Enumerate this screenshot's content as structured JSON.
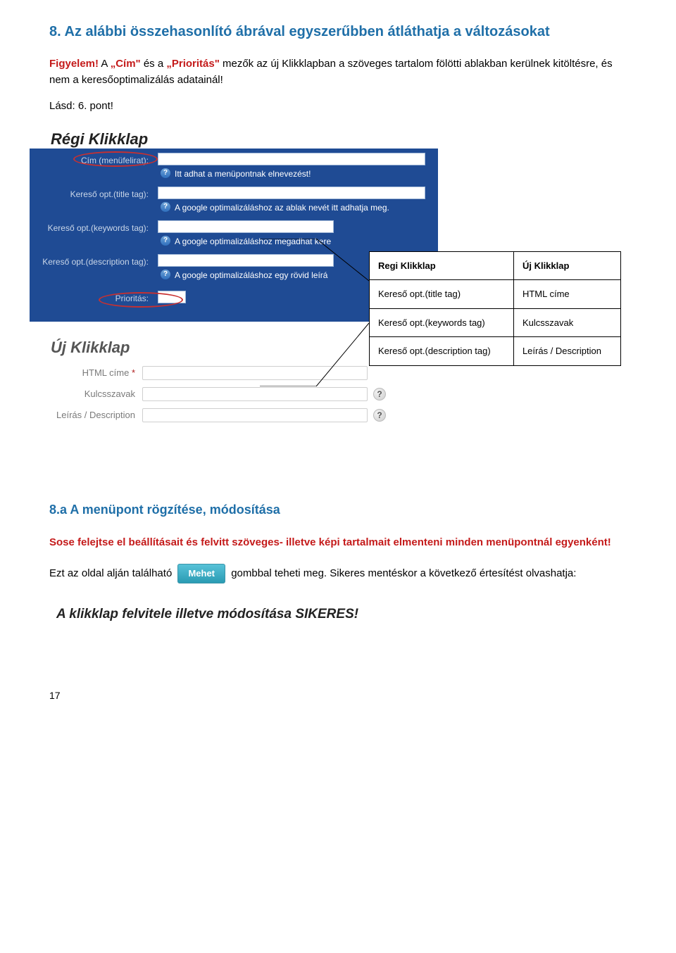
{
  "heading8": "8. Az alábbi összehasonlító ábrával egyszerűbben átláthatja a változásokat",
  "intro": {
    "figyelem": "Figyelem!",
    "t1": " A ",
    "cim": "„Cím\"",
    "t2": " és a ",
    "prioritas": "„Prioritás\"",
    "t3": " mezők az új Klikklapban a szöveges tartalom fölötti ablakban kerülnek kitöltésre, és nem a keresőoptimalizálás adatainál!"
  },
  "see": "Lásd: 6. pont!",
  "oldPanel": {
    "title": "Régi Klikklap",
    "rows": [
      {
        "label": "Cím (menüfelirat):",
        "help": "Itt adhat a menüpontnak elnevezést!"
      },
      {
        "label": "Kereső opt.(title tag):",
        "help": "A google optimalizáláshoz az ablak nevét itt adhatja meg."
      },
      {
        "label": "Kereső opt.(keywords tag):",
        "help": "A google optimalizáláshoz megadhat kere"
      },
      {
        "label": "Kereső opt.(description tag):",
        "help": "A google optimalizáláshoz egy rövid leírá"
      }
    ],
    "prioritasLabel": "Prioritás:"
  },
  "newPanel": {
    "title": "Új Klikklap",
    "rows": [
      {
        "label": "HTML címe",
        "required": true
      },
      {
        "label": "Kulcsszavak",
        "required": false,
        "qmark": true
      },
      {
        "label": "Leírás / Description",
        "required": false,
        "qmark": true
      }
    ]
  },
  "mapping": {
    "head_old": "Regi Klikklap",
    "head_new": "Új Klikklap",
    "rows": [
      {
        "old": "Kereső opt.(title tag)",
        "new": "HTML címe"
      },
      {
        "old": "Kereső opt.(keywords tag)",
        "new": "Kulcsszavak"
      },
      {
        "old": "Kereső opt.(description tag)",
        "new": "Leírás / Description"
      }
    ]
  },
  "heading8a": "8.a A menüpont rögzítése, módosítása",
  "warn": "Sose felejtse el beállításait és felvitt szöveges- illetve képi tartalmait elmenteni minden menüpontnál egyenként!",
  "para": {
    "p1": "Ezt az oldal alján található",
    "btn": "Mehet",
    "p2": "gombbal teheti meg. Sikeres mentéskor a következő értesítést olvashatja:"
  },
  "success": "A klikklap felvitele illetve módosítása SIKERES!",
  "pagenum": "17"
}
